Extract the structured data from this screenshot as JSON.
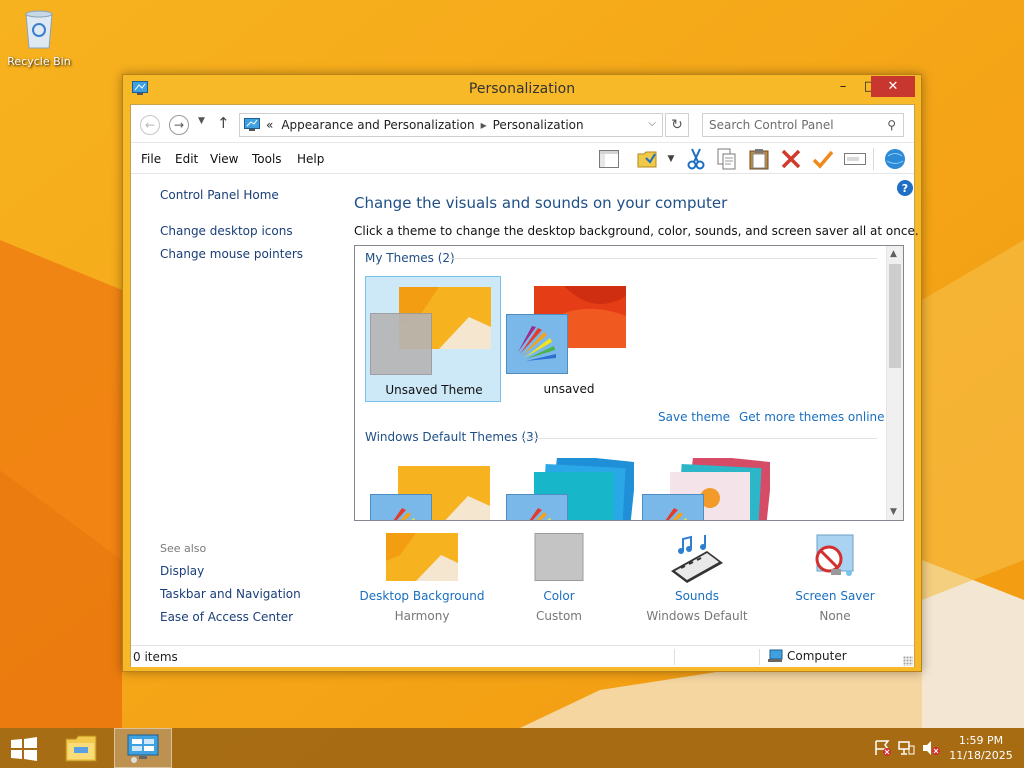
{
  "desktop": {
    "icons": [
      {
        "label": "Recycle Bin",
        "icon": "recycle-bin-icon"
      }
    ]
  },
  "window": {
    "title": "Personalization",
    "controls": {
      "minimize": "–",
      "maximize": "□",
      "close": "✕"
    }
  },
  "address_bar": {
    "breadcrumb_prefix": "«",
    "breadcrumb": [
      "Appearance and Personalization",
      "Personalization"
    ],
    "search_placeholder": "Search Control Panel"
  },
  "menu": {
    "items": [
      "File",
      "Edit",
      "View",
      "Tools",
      "Help"
    ],
    "toolbar_icons": [
      "layout-pane-icon",
      "folder-options-icon",
      "cut-icon",
      "copy-icon",
      "paste-icon",
      "delete-icon",
      "properties-check-icon",
      "rename-icon",
      "control-panel-globe-icon"
    ]
  },
  "left_panel": {
    "links": [
      "Control Panel Home",
      "Change desktop icons",
      "Change mouse pointers"
    ],
    "see_also_heading": "See also",
    "see_also": [
      "Display",
      "Taskbar and Navigation",
      "Ease of Access Center"
    ]
  },
  "main": {
    "heading": "Change the visuals and sounds on your computer",
    "subheading": "Click a theme to change the desktop background, color, sounds, and screen saver all at once.",
    "my_themes_label": "My Themes (2)",
    "my_themes": [
      {
        "name": "Unsaved Theme",
        "selected": true
      },
      {
        "name": "unsaved",
        "selected": false
      }
    ],
    "save_theme": "Save theme",
    "get_more": "Get more themes online",
    "default_themes_label": "Windows Default Themes (3)"
  },
  "settings": [
    {
      "label": "Desktop Background",
      "value": "Harmony",
      "icon": "desktop-background-icon"
    },
    {
      "label": "Color",
      "value": "Custom",
      "icon": "color-swatch-icon"
    },
    {
      "label": "Sounds",
      "value": "Windows Default",
      "icon": "sounds-icon"
    },
    {
      "label": "Screen Saver",
      "value": "None",
      "icon": "screen-saver-icon"
    }
  ],
  "status_bar": {
    "items": "0 items",
    "zone": "Computer"
  },
  "taskbar": {
    "time": "1:59 PM",
    "date": "11/18/2025"
  },
  "colors": {
    "accent": "#f8b929",
    "link": "#1a6fc1",
    "heading": "#1e4f86",
    "close": "#c7372f"
  }
}
